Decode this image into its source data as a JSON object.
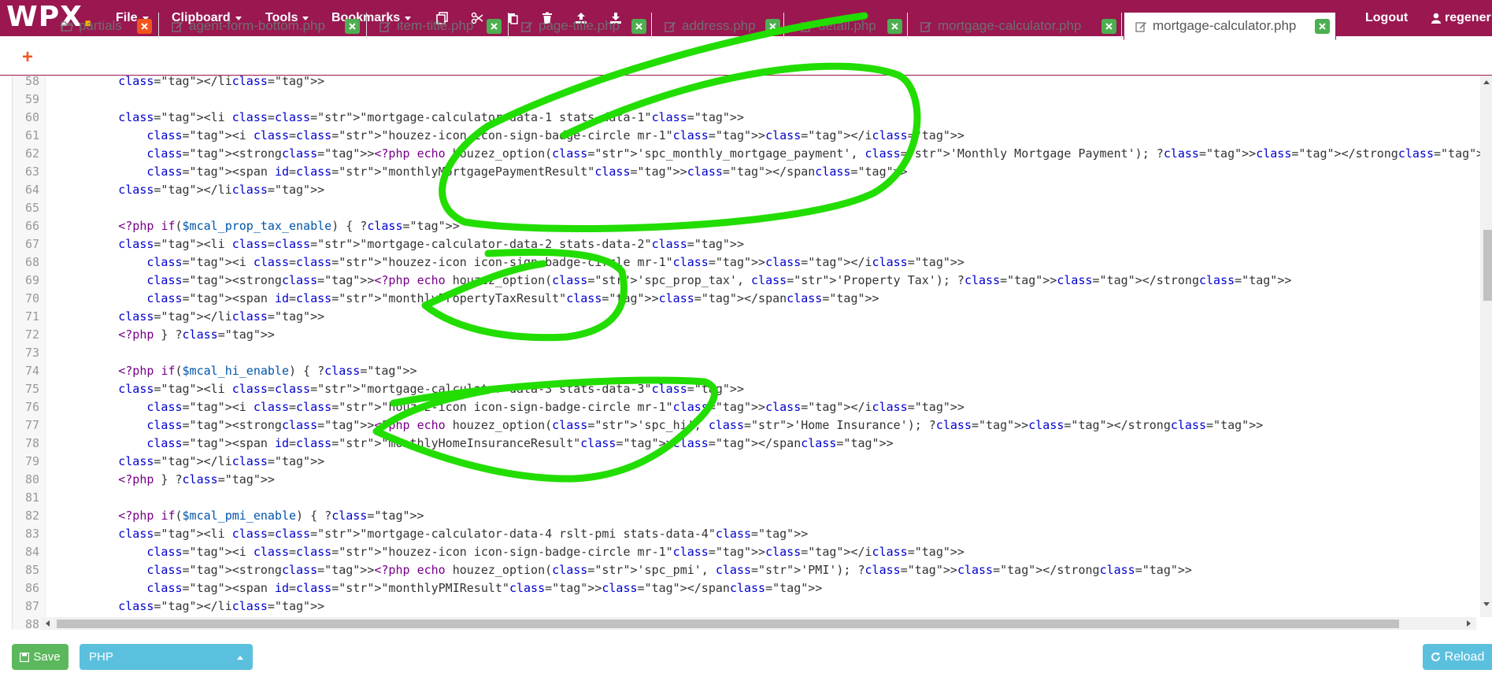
{
  "app": {
    "logo_text": "WPX",
    "logo_dot": "."
  },
  "menu": {
    "file": "File",
    "clipboard": "Clipboard",
    "tools": "Tools",
    "bookmarks": "Bookmarks",
    "logout": "Logout",
    "user": "regener"
  },
  "colors": {
    "brand": "#9a1750",
    "accent_dot": "#f5b800",
    "save": "#5cb85c",
    "info": "#5bc0de",
    "close_green": "#4caf50",
    "close_red": "#f2541d",
    "annotation": "#22dd00"
  },
  "toolbar_icons": [
    "copy-icon",
    "cut-icon",
    "paste-icon",
    "trash-icon",
    "upload-icon",
    "download-icon"
  ],
  "tabs": [
    {
      "label": "partials",
      "icon": "folder-open-icon"
    },
    {
      "label": "agent-form-bottom.php",
      "icon": "edit-icon"
    },
    {
      "label": "item-title.php",
      "icon": "edit-icon"
    },
    {
      "label": "page-title.php",
      "icon": "edit-icon"
    },
    {
      "label": "address.php",
      "icon": "edit-icon"
    },
    {
      "label": "detail.php",
      "icon": "edit-icon"
    },
    {
      "label": "mortgage-calculator.php",
      "icon": "edit-icon"
    },
    {
      "label": "mortgage-calculator.php",
      "icon": "edit-icon",
      "active": true
    }
  ],
  "editor": {
    "line_numbers": [
      "58",
      "59",
      "60",
      "61",
      "62",
      "63",
      "64",
      "65",
      "66",
      "67",
      "68",
      "69",
      "70",
      "71",
      "72",
      "73",
      "74",
      "75",
      "76",
      "77",
      "78",
      "79",
      "80",
      "81",
      "82",
      "83",
      "84",
      "85",
      "86",
      "87",
      "88"
    ],
    "code_lines": [
      "        </li>",
      "",
      "        <li class=\"mortgage-calculator-data-1 stats-data-1\">",
      "            <i class=\"houzez-icon icon-sign-badge-circle mr-1\"></i>",
      "            <strong><?php echo houzez_option('spc_monthly_mortgage_payment', 'Monthly Mortgage Payment'); ?></strong>",
      "            <span id=\"monthlyMortgagePaymentResult\"></span>",
      "        </li>",
      "",
      "        <?php if($mcal_prop_tax_enable) { ?>",
      "        <li class=\"mortgage-calculator-data-2 stats-data-2\">",
      "            <i class=\"houzez-icon icon-sign-badge-circle mr-1\"></i>",
      "            <strong><?php echo houzez_option('spc_prop_tax', 'Property Tax'); ?></strong>",
      "            <span id=\"monthlyPropertyTaxResult\"></span>",
      "        </li>",
      "        <?php } ?>",
      "",
      "        <?php if($mcal_hi_enable) { ?>",
      "        <li class=\"mortgage-calculator-data-3 stats-data-3\">",
      "            <i class=\"houzez-icon icon-sign-badge-circle mr-1\"></i>",
      "            <strong><?php echo houzez_option('spc_hi', 'Home Insurance'); ?></strong>",
      "            <span id=\"monthlyHomeInsuranceResult\"></span>",
      "        </li>",
      "        <?php } ?>",
      "",
      "        <?php if($mcal_pmi_enable) { ?>",
      "        <li class=\"mortgage-calculator-data-4 rslt-pmi stats-data-4\">",
      "            <i class=\"houzez-icon icon-sign-badge-circle mr-1\"></i>",
      "            <strong><?php echo houzez_option('spc_pmi', 'PMI'); ?></strong>",
      "            <span id=\"monthlyPMIResult\"></span>",
      "        </li>",
      ""
    ]
  },
  "footer": {
    "save": "Save",
    "language": "PHP",
    "reload": "Reload"
  }
}
